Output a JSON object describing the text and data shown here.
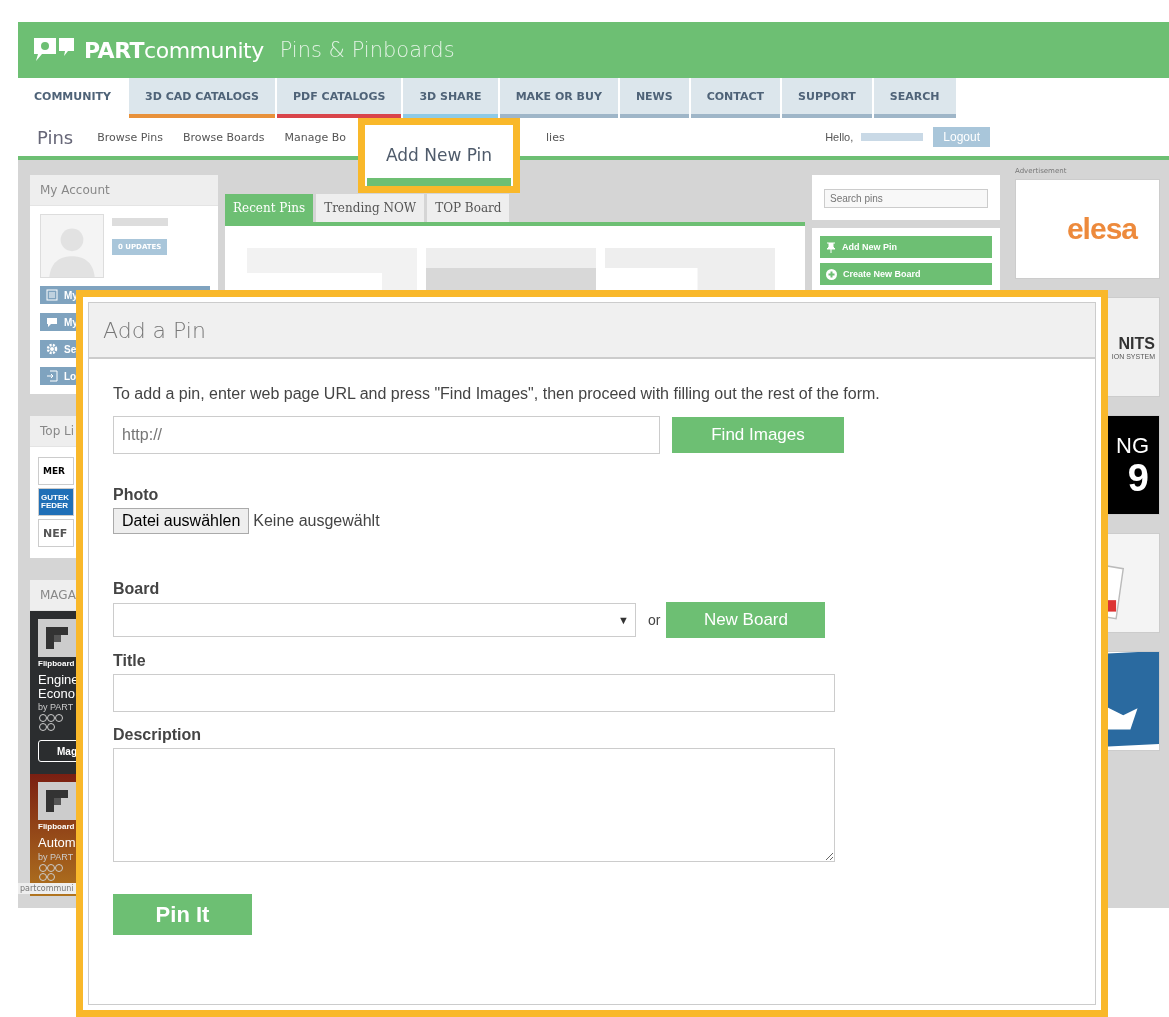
{
  "header": {
    "brand_bold": "PART",
    "brand_light": "community",
    "section": "Pins & Pinboards"
  },
  "nav": [
    {
      "label": "COMMUNITY",
      "selected": true,
      "color": "#ffffff"
    },
    {
      "label": "3D CAD CATALOGS",
      "selected": false,
      "color": "#e8913a"
    },
    {
      "label": "PDF CATALOGS",
      "selected": false,
      "color": "#d9444a"
    },
    {
      "label": "3D SHARE",
      "selected": false,
      "color": "#8ecae6"
    },
    {
      "label": "MAKE OR BUY",
      "selected": false,
      "color": "#9fb6c8"
    },
    {
      "label": "NEWS",
      "selected": false,
      "color": "#9fb6c8"
    },
    {
      "label": "CONTACT",
      "selected": false,
      "color": "#9fb6c8"
    },
    {
      "label": "SUPPORT",
      "selected": false,
      "color": "#9fb6c8"
    },
    {
      "label": "SEARCH",
      "selected": false,
      "color": "#9fb6c8"
    }
  ],
  "subnav": {
    "title": "Pins",
    "links": [
      "Browse Pins",
      "Browse Boards",
      "Manage Bo"
    ],
    "link_after": "lies",
    "greeting": "Hello,",
    "logout": "Logout"
  },
  "account": {
    "title": "My Account",
    "badge": "0 UPDATES",
    "menu": [
      {
        "kind": "list",
        "label": "My"
      },
      {
        "kind": "chat",
        "label": "My"
      },
      {
        "kind": "gear",
        "label": "Se"
      },
      {
        "kind": "exit",
        "label": "Lo"
      }
    ]
  },
  "top_list": {
    "title": "Top Li",
    "logos": [
      {
        "kind": "mer",
        "text": "MER"
      },
      {
        "kind": "guteku",
        "text": "GUTEK",
        "text2": "FEDER"
      },
      {
        "kind": "nef",
        "text": "NEF"
      }
    ]
  },
  "magazines": {
    "title": "MAGA",
    "items": [
      {
        "kind": "dark",
        "brand": "Flipboard",
        "lines": [
          "Engine",
          "Econo"
        ],
        "byline": "by PART",
        "button": "Mag"
      },
      {
        "kind": "warm",
        "brand": "Flipboard",
        "lines": [
          "Autom"
        ],
        "byline": "by PART"
      }
    ]
  },
  "pin_tabs": [
    {
      "label": "Recent Pins",
      "selected": true
    },
    {
      "label": "Trending NOW",
      "selected": false
    },
    {
      "label": "TOP Board",
      "selected": false
    }
  ],
  "pins": [
    {
      "kind": "picture"
    },
    {
      "kind": "picture"
    },
    {
      "kind": "picture"
    }
  ],
  "sidebar": {
    "search": {
      "placeholder": "Search pins"
    },
    "actions": [
      {
        "kind": "pin",
        "label": "Add New Pin"
      },
      {
        "kind": "plus",
        "label": "Create New Board"
      }
    ]
  },
  "ads": {
    "label": "Advertisement",
    "items": [
      {
        "kind": "logo",
        "text": "elesa"
      },
      {
        "kind": "units",
        "text": "NITS",
        "text2": "ION SYSTEM"
      },
      {
        "kind": "black",
        "text": "NG",
        "text2": "9"
      },
      {
        "kind": "picture"
      },
      {
        "kind": "picture"
      }
    ]
  },
  "status_bar": "partcommuni",
  "callout": {
    "label": "Add New Pin"
  },
  "dialog": {
    "title": "Add a Pin",
    "instructions": "To add a pin, enter web page URL and press \"Find Images\", then proceed with filling out the rest of the form.",
    "url": {
      "placeholder": "http://"
    },
    "find_button": "Find Images",
    "photo_label": "Photo",
    "file_button": "Datei auswählen",
    "file_status": "Keine ausgewählt",
    "board_label": "Board",
    "board_caret": "▼",
    "board_or": "or",
    "new_board_button": "New Board",
    "title_label": "Title",
    "description_label": "Description",
    "submit": "Pin It"
  }
}
